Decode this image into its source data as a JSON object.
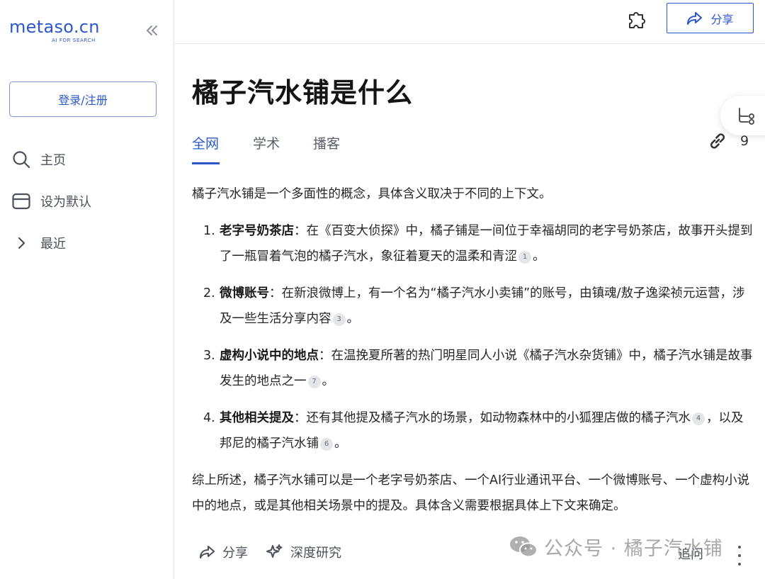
{
  "sidebar": {
    "logo": "metaso.cn",
    "logo_tagline": "AI FOR SEARCH",
    "login_label": "登录/注册",
    "nav": [
      {
        "label": "主页",
        "icon": "search-icon"
      },
      {
        "label": "设为默认",
        "icon": "browser-window-icon"
      },
      {
        "label": "最近",
        "icon": "chevron-right-icon"
      }
    ]
  },
  "topbar": {
    "share_label": "分享"
  },
  "main": {
    "title": "橘子汽水铺是什么",
    "tabs": [
      "全网",
      "学术",
      "播客"
    ],
    "active_tab": "全网",
    "source_count": "9",
    "intro": "橘子汽水铺是一个多面性的概念，具体含义取决于不同的上下文。",
    "items": [
      {
        "num": "1.",
        "title": "老字号奶茶店",
        "text": "：在《百变大侦探》中，橘子铺是一间位于幸福胡同的老字号奶茶店，故事开头提到了一瓶冒着气泡的橘子汽水，象征着夏天的温柔和青涩",
        "cite": "1",
        "tail": "。"
      },
      {
        "num": "2.",
        "title": "微博账号",
        "text": "：在新浪微博上，有一个名为“橘子汽水小卖铺”的账号，由镇魂/敖子逸梁祯元运营，涉及一些生活分享内容",
        "cite": "3",
        "tail": "。"
      },
      {
        "num": "3.",
        "title": "虚构小说中的地点",
        "text": "：在温挽夏所著的热门明星同人小说《橘子汽水杂货铺》中，橘子汽水铺是故事发生的地点之一",
        "cite": "7",
        "tail": "。"
      },
      {
        "num": "4.",
        "title": "其他相关提及",
        "text": "：还有其他提及橘子汽水的场景，如动物森林中的小狐狸店做的橘子汽水",
        "cite": "4",
        "mid": "，以及邦尼的橘子汽水铺",
        "cite2": "6",
        "tail": "。"
      }
    ],
    "summary": "综上所述，橘子汽水铺可以是一个老字号奶茶店、一个AI行业通讯平台、一个微博账号、一个虚构小说中的地点，或是其他相关场景中的提及。具体含义需要根据具体上下文来确定。"
  },
  "actions": {
    "share_label": "分享",
    "research_label": "深度研究",
    "followup_label": "追问"
  },
  "watermark": {
    "text": "公众号 · 橘子汽水铺"
  },
  "colors": {
    "accent": "#2a57c9"
  }
}
